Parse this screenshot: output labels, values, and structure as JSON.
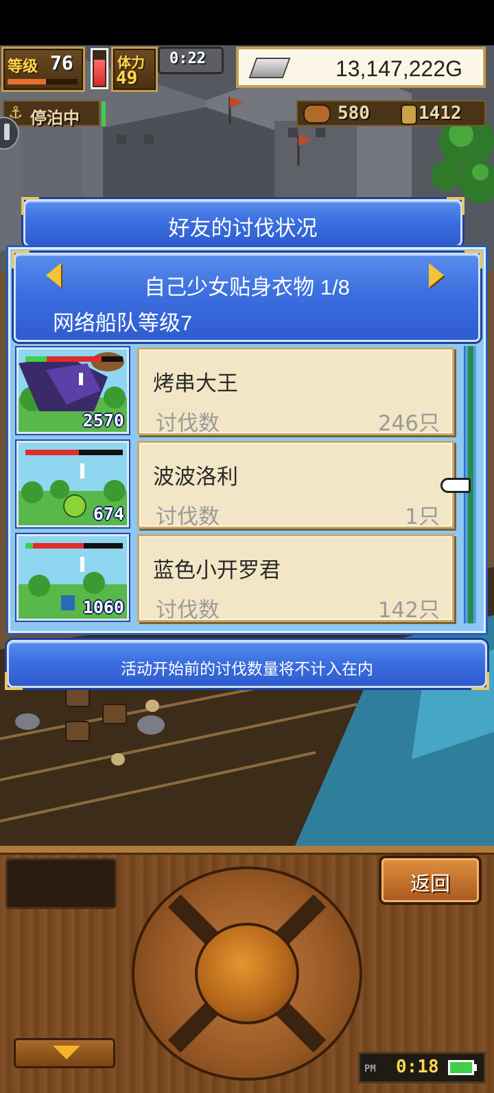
{
  "hud": {
    "level_label": "等级",
    "level_value": "76",
    "stamina_label": "体力",
    "stamina_value": "49",
    "timer": "0:22",
    "gold": "13,147,222G",
    "status": "停泊中",
    "resource_1": "580",
    "resource_2": "1412"
  },
  "dialog": {
    "title": "好友的讨伐状况",
    "subtitle": "自己少女贴身衣物 1/8",
    "fleet_level": "网络船队等级7",
    "footer_note": "活动开始前的讨伐数量将不计入在内",
    "entries": [
      {
        "name": "烤串大王",
        "kill_label": "讨伐数",
        "kill_count": "246只",
        "thumb_number": "2570",
        "hp": 0.78,
        "green": 0.22
      },
      {
        "name": "波波洛利",
        "kill_label": "讨伐数",
        "kill_count": "1只",
        "thumb_number": "674",
        "hp": 0.55,
        "green": 0.0
      },
      {
        "name": "蓝色小开罗君",
        "kill_label": "讨伐数",
        "kill_count": "142只",
        "thumb_number": "1060",
        "hp": 0.6,
        "green": 0.08
      }
    ]
  },
  "controls": {
    "back_label": "返回",
    "clock_ampm": "PM",
    "clock": "0:18"
  },
  "colors": {
    "dialog_blue": "#3c6fe0",
    "card_cream": "#f3e6c6",
    "wood": "#7a4a22",
    "gold_text": "#ffd84a"
  }
}
